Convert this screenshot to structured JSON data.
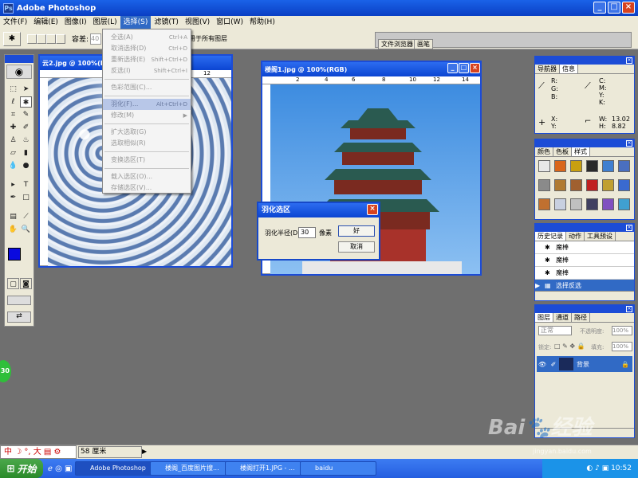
{
  "app": {
    "title": "Adobe Photoshop",
    "icon": "Ps"
  },
  "menubar": [
    "文件(F)",
    "编辑(E)",
    "图像(I)",
    "图层(L)",
    "选择(S)",
    "滤镜(T)",
    "视图(V)",
    "窗口(W)",
    "帮助(H)"
  ],
  "options": {
    "tolerance_label": "容差:",
    "tolerance_value": "40",
    "all_layers_label": "用于所有图层",
    "tab_browser": "文件浏览器",
    "tab_brushes": "画笔"
  },
  "select_menu": {
    "items": [
      {
        "label": "全选(A)",
        "shortcut": "Ctrl+A"
      },
      {
        "label": "取消选择(D)",
        "shortcut": "Ctrl+D"
      },
      {
        "label": "重新选择(E)",
        "shortcut": "Shift+Ctrl+D"
      },
      {
        "label": "反选(I)",
        "shortcut": "Shift+Ctrl+I"
      },
      {
        "label": "色彩范围(C)...",
        "shortcut": ""
      },
      {
        "label": "羽化(F)...",
        "shortcut": "Alt+Ctrl+D"
      },
      {
        "label": "修改(M)",
        "shortcut": "▶"
      },
      {
        "label": "扩大选取(G)",
        "shortcut": ""
      },
      {
        "label": "选取相似(R)",
        "shortcut": ""
      },
      {
        "label": "变换选区(T)",
        "shortcut": ""
      },
      {
        "label": "载入选区(O)...",
        "shortcut": ""
      },
      {
        "label": "存储选区(V)...",
        "shortcut": ""
      }
    ]
  },
  "doc1": {
    "title": "云2.jpg @ 100%(R"
  },
  "doc2": {
    "title": "楼阁1.jpg @ 100%(RGB)"
  },
  "ruler_labels": {
    "r2": "2",
    "r4": "4",
    "r6": "6",
    "r8": "8",
    "r10": "10",
    "r12": "12",
    "r14": "14"
  },
  "feather_dialog": {
    "title": "羽化选区",
    "radius_label": "羽化半径(D):",
    "radius_value": "30",
    "unit": "像素",
    "ok": "好",
    "cancel": "取消"
  },
  "navigator": {
    "tabs": [
      "导航器",
      "信息"
    ],
    "rgb": "R:\nG:\nB:",
    "cmyk": "C:\nM:\nY:\nK:",
    "xy": "X:\nY:",
    "w_label": "W:",
    "w_value": "13.02",
    "h_label": "H:",
    "h_value": "8.82"
  },
  "swatches": {
    "tabs": [
      "颜色",
      "色板",
      "样式"
    ],
    "colors": [
      "#e8e8e8",
      "#d9661a",
      "#c8a010",
      "#2a2a2a",
      "#3f7fd0",
      "#4a6fc0",
      "#8a8a8a",
      "#b07a30",
      "#a06030",
      "#c02020",
      "#c0a030",
      "#3a6ad0",
      "#c07030",
      "#c8d0e0",
      "#c0c0c0",
      "#404060",
      "#8050c0",
      "#40a0d0"
    ]
  },
  "history": {
    "tabs": [
      "历史记录",
      "动作",
      "工具预设"
    ],
    "items": [
      "魔棒",
      "魔棒",
      "魔棒",
      "选择反选"
    ]
  },
  "layers": {
    "tabs": [
      "图层",
      "通道",
      "路径"
    ],
    "mode": "正常",
    "opacity_label": "不透明度:",
    "opacity_value": "100%",
    "lock_label": "锁定:",
    "fill_label": "填充:",
    "fill_value": "100%",
    "layer_name": "背景"
  },
  "statusbar": {
    "zoom": "58 厘米",
    "ime": "中",
    "ime2": "大"
  },
  "taskbar": {
    "start": "开始",
    "tasks": [
      "Adobe Photoshop",
      "楼阁_百度图片搜...",
      "楼阁打开1.JPG - ...",
      "baidu"
    ],
    "clock": "10:52"
  },
  "watermark": {
    "site": "jingyan.baidu.com"
  },
  "badge": "30"
}
